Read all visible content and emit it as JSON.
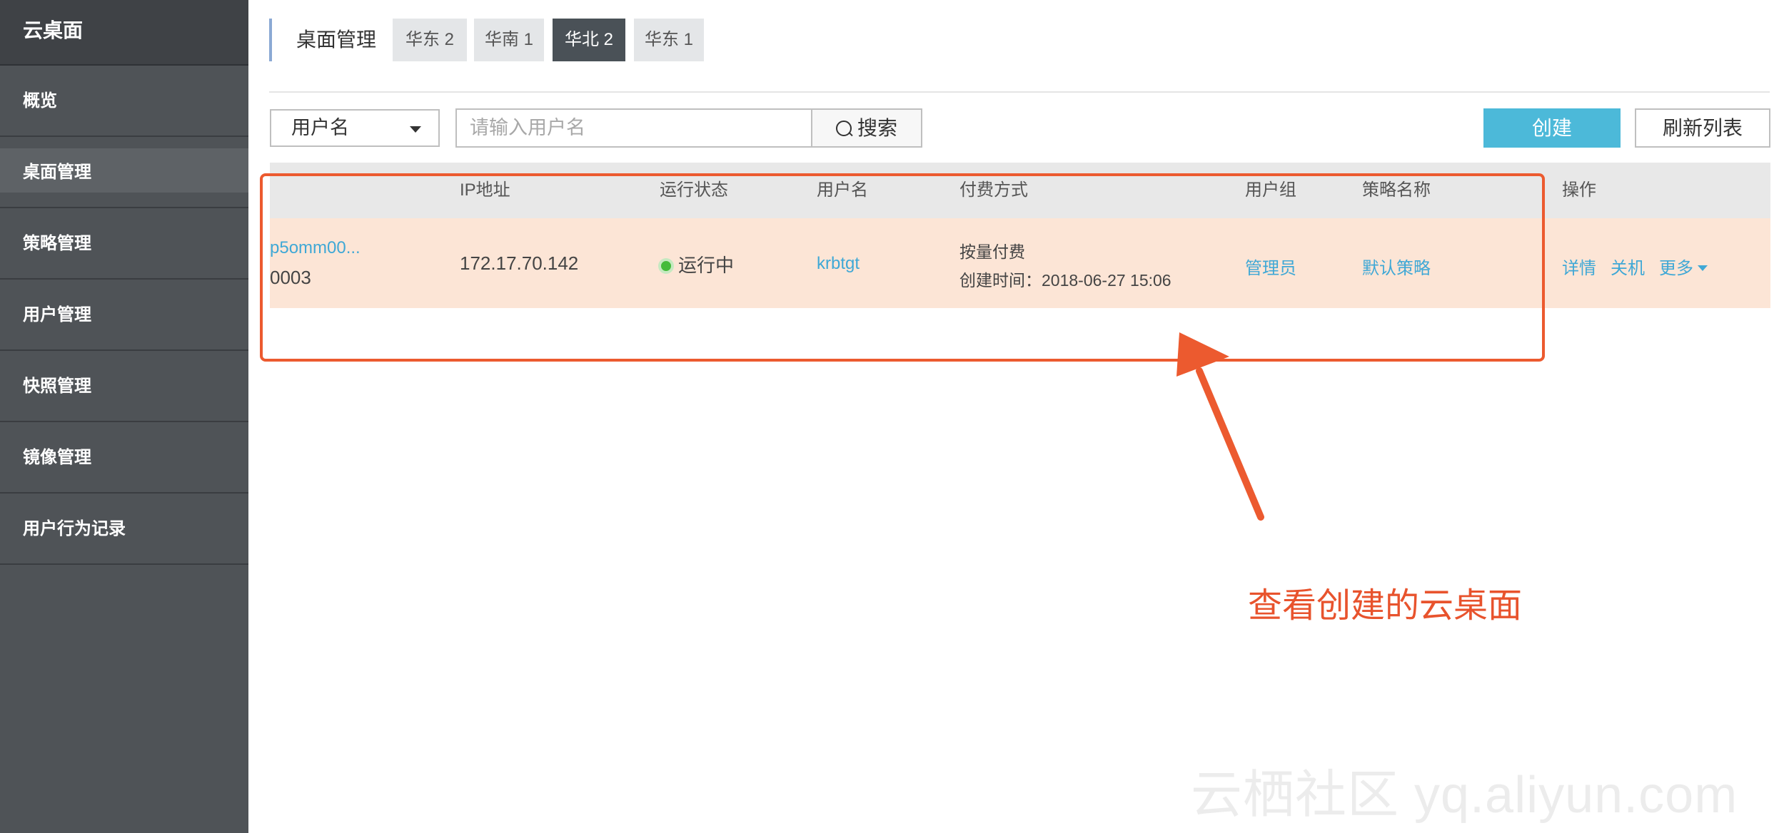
{
  "sidebar": {
    "title": "云桌面",
    "items": [
      {
        "label": "概览"
      },
      {
        "label": "桌面管理"
      },
      {
        "label": "策略管理"
      },
      {
        "label": "用户管理"
      },
      {
        "label": "快照管理"
      },
      {
        "label": "镜像管理"
      },
      {
        "label": "用户行为记录"
      }
    ]
  },
  "header": {
    "title": "桌面管理",
    "regions": [
      {
        "label": "华东 2"
      },
      {
        "label": "华南 1"
      },
      {
        "label": "华北 2"
      },
      {
        "label": "华东 1"
      }
    ],
    "selected_region": "华北 2"
  },
  "toolbar": {
    "filter_select": "用户名",
    "search_placeholder": "请输入用户名",
    "search_label": "搜索",
    "create_label": "创建",
    "refresh_label": "刷新列表"
  },
  "table": {
    "columns": [
      "IP地址",
      "运行状态",
      "用户名",
      "付费方式",
      "用户组",
      "策略名称",
      "操作"
    ],
    "rows": [
      {
        "id_line1": "p5omm00...",
        "id_line2": "0003",
        "ip": "172.17.70.142",
        "status": "运行中",
        "username": "krbtgt",
        "billing": "按量付费",
        "created": "创建时间：2018-06-27 15:06",
        "group": "管理员",
        "policy": "默认策略",
        "actions": {
          "detail": "详情",
          "shutdown": "关机",
          "more": "更多"
        }
      }
    ]
  },
  "annotation": {
    "text": "查看创建的云桌面",
    "color": "#e8532d"
  },
  "watermark": "云栖社区 yq.aliyun.com",
  "colors": {
    "sidebar_bg": "#4f5357",
    "accent": "#4cb9d9",
    "link": "#3fa8d6",
    "row_highlight": "#fce5d6",
    "status_running": "#44bb3a"
  }
}
